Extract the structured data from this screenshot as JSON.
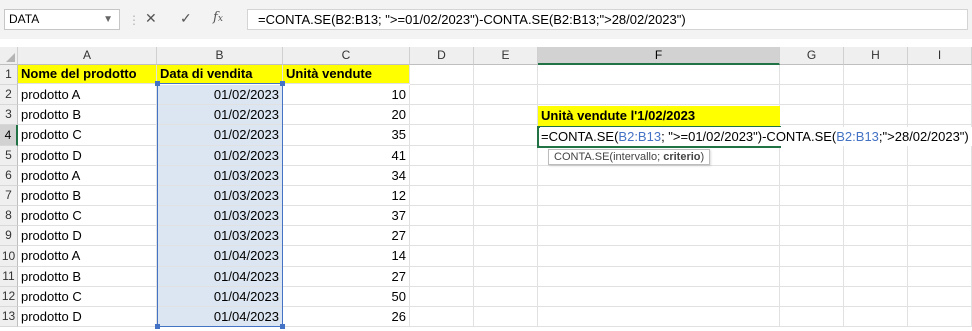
{
  "formula_bar": {
    "name_box": "DATA",
    "formula_prefix": "=CONTA.SE(B2:B13; \">=01/02/2023\")-CONTA.SE(B2:B13;\">28/02/2023\")",
    "fx_icon": "fx-icon",
    "cancel_icon": "close-icon",
    "enter_icon": "check-icon"
  },
  "columns": [
    "A",
    "B",
    "C",
    "D",
    "E",
    "F",
    "G",
    "H",
    "I"
  ],
  "rows": [
    "1",
    "2",
    "3",
    "4",
    "5",
    "6",
    "7",
    "8",
    "9",
    "10",
    "11",
    "12",
    "13"
  ],
  "headers": {
    "a1": "Nome del prodotto",
    "b1": "Data di vendita",
    "c1": "Unità vendute"
  },
  "table": [
    {
      "product": "prodotto A",
      "date": "01/02/2023",
      "units": "10"
    },
    {
      "product": "prodotto B",
      "date": "01/02/2023",
      "units": "20"
    },
    {
      "product": "prodotto C",
      "date": "01/02/2023",
      "units": "35"
    },
    {
      "product": "prodotto D",
      "date": "01/02/2023",
      "units": "41"
    },
    {
      "product": "prodotto A",
      "date": "01/03/2023",
      "units": "34"
    },
    {
      "product": "prodotto B",
      "date": "01/03/2023",
      "units": "12"
    },
    {
      "product": "prodotto C",
      "date": "01/03/2023",
      "units": "37"
    },
    {
      "product": "prodotto D",
      "date": "01/03/2023",
      "units": "27"
    },
    {
      "product": "prodotto A",
      "date": "01/04/2023",
      "units": "14"
    },
    {
      "product": "prodotto B",
      "date": "01/04/2023",
      "units": "27"
    },
    {
      "product": "prodotto C",
      "date": "01/04/2023",
      "units": "50"
    },
    {
      "product": "prodotto D",
      "date": "01/04/2023",
      "units": "26"
    }
  ],
  "summary": {
    "label": "Unità vendute l'1/02/2023",
    "formula_parts": [
      "=CONTA.SE(",
      "B2:B13",
      "; \">=01/02/2023\")-CONTA.SE(",
      "B2:B13",
      ";\">28/02/2023\")"
    ]
  },
  "tooltip": {
    "func": "CONTA.SE(intervallo; ",
    "arg": "criterio",
    "close": ")"
  },
  "colors": {
    "header_fill": "#ffff00",
    "selection_fill": "#dce6f2",
    "ref_blue": "#4472c4",
    "excel_green": "#217346"
  }
}
